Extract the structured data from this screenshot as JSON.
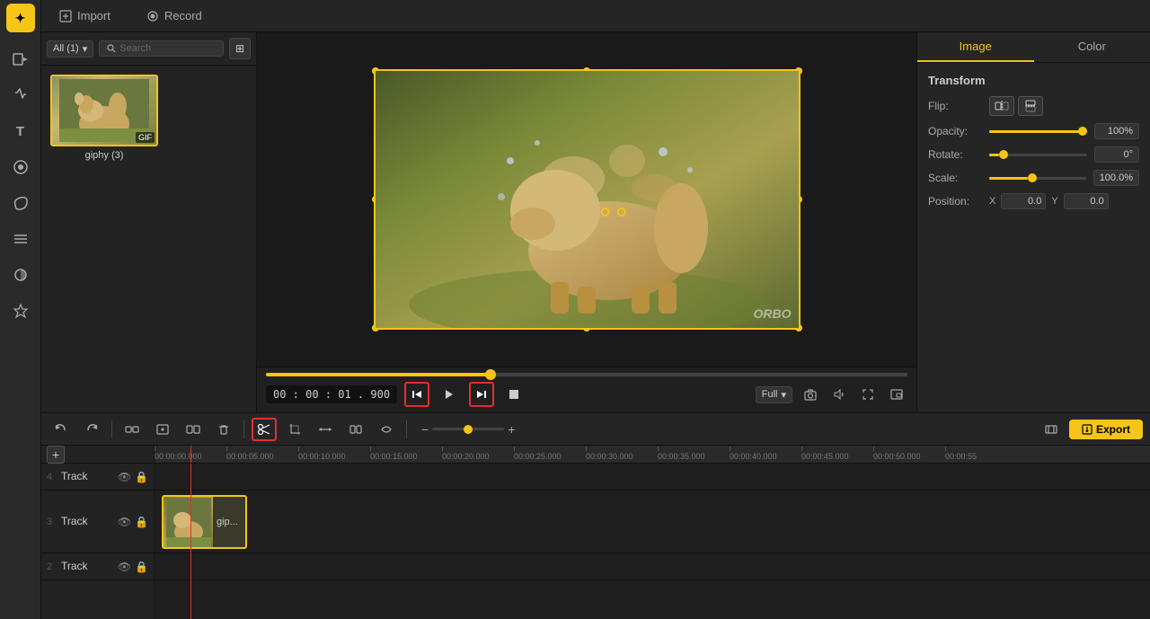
{
  "sidebar": {
    "logo_label": "App",
    "items": [
      {
        "name": "media-icon",
        "symbol": "⬡",
        "label": "Media"
      },
      {
        "name": "audio-icon",
        "symbol": "≋",
        "label": "Audio"
      },
      {
        "name": "text-icon",
        "symbol": "T",
        "label": "Text"
      },
      {
        "name": "effects-icon",
        "symbol": "⊕",
        "label": "Effects"
      },
      {
        "name": "stickers-icon",
        "symbol": "☁",
        "label": "Stickers"
      },
      {
        "name": "transitions-icon",
        "symbol": "≡",
        "label": "Transitions"
      },
      {
        "name": "filters-icon",
        "symbol": "◎",
        "label": "Filters"
      },
      {
        "name": "favorites-icon",
        "symbol": "☆",
        "label": "Favorites"
      }
    ]
  },
  "topbar": {
    "import_label": "Import",
    "record_label": "Record"
  },
  "media_panel": {
    "dropdown_label": "All (1)",
    "search_placeholder": "Search",
    "items": [
      {
        "name": "giphy (3)",
        "label": "giphy (3)"
      }
    ]
  },
  "preview": {
    "time_display": "00 : 00 : 01 . 900",
    "zoom_label": "Full",
    "watermark": "ORBO"
  },
  "right_panel": {
    "tab_image": "Image",
    "tab_color": "Color",
    "section_transform": "Transform",
    "flip_label": "Flip:",
    "opacity_label": "Opacity:",
    "opacity_value": "100%",
    "rotate_label": "Rotate:",
    "rotate_value": "0°",
    "scale_label": "Scale:",
    "scale_value": "100.0%",
    "position_label": "Position:",
    "position_x_label": "X",
    "position_x_value": "0.0",
    "position_y_label": "Y",
    "position_y_value": "0.0"
  },
  "timeline": {
    "toolbar": {
      "undo_label": "↩",
      "redo_label": "↪",
      "group_label": "⊞",
      "add_label": "+",
      "remove_label": "⊟",
      "delete_label": "🗑",
      "cut_label": "✂",
      "crop_label": "⊡",
      "resize_label": "↔",
      "split_label": "⊟",
      "zoom_minus": "−",
      "zoom_plus": "+",
      "export_label": "Export"
    },
    "ruler_marks": [
      "00:00:00.000",
      "00:00:05.000",
      "00:00:10.000",
      "00:00:15.000",
      "00:00:20.000",
      "00:00:25.000",
      "00:00:30.000",
      "00:00:35.000",
      "00:00:40.000",
      "00:00:45.000",
      "00:00:50.000",
      "00:00:55"
    ],
    "tracks": [
      {
        "number": "4",
        "name": "Track",
        "has_clip": false
      },
      {
        "number": "3",
        "name": "Track",
        "has_clip": true,
        "clip_label": "gip..."
      },
      {
        "number": "2",
        "name": "Track",
        "has_clip": false
      }
    ],
    "add_track_label": "+"
  }
}
